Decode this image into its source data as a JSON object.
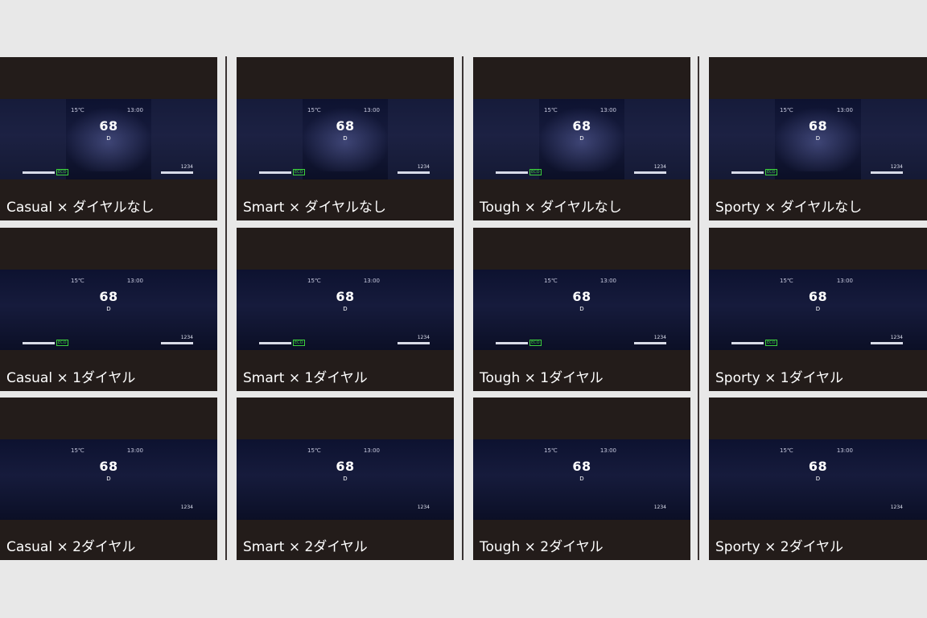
{
  "colors": {
    "page_bg": "#e8e8e8",
    "panel_bg": "#231c1a",
    "casual_accent": "#3d5fc7",
    "smart_accent": "#5a7fe0",
    "tough_accent": "#c7c7c7",
    "sporty_accent": "#c8283a"
  },
  "hud": {
    "temperature": "15℃",
    "time": "13:00",
    "speed": "68",
    "gear": "D",
    "odometer": "1234",
    "eco_label": "ECO"
  },
  "panels": [
    {
      "theme": "casual",
      "dial": "none",
      "caption": "Casual × ダイヤルなし"
    },
    {
      "theme": "smart",
      "dial": "none",
      "caption": "Smart × ダイヤルなし"
    },
    {
      "theme": "tough",
      "dial": "none",
      "caption": "Tough × ダイヤルなし"
    },
    {
      "theme": "sporty",
      "dial": "none",
      "caption": "Sporty × ダイヤルなし"
    },
    {
      "theme": "casual",
      "dial": "one",
      "caption": "Casual × 1ダイヤル"
    },
    {
      "theme": "smart",
      "dial": "one",
      "caption": "Smart × 1ダイヤル"
    },
    {
      "theme": "tough",
      "dial": "one",
      "caption": "Tough × 1ダイヤル"
    },
    {
      "theme": "sporty",
      "dial": "one",
      "caption": "Sporty × 1ダイヤル"
    },
    {
      "theme": "casual",
      "dial": "two",
      "caption": "Casual × 2ダイヤル"
    },
    {
      "theme": "smart",
      "dial": "two",
      "caption": "Smart × 2ダイヤル"
    },
    {
      "theme": "tough",
      "dial": "two",
      "caption": "Tough × 2ダイヤル"
    },
    {
      "theme": "sporty",
      "dial": "two",
      "caption": "Sporty × 2ダイヤル"
    }
  ]
}
